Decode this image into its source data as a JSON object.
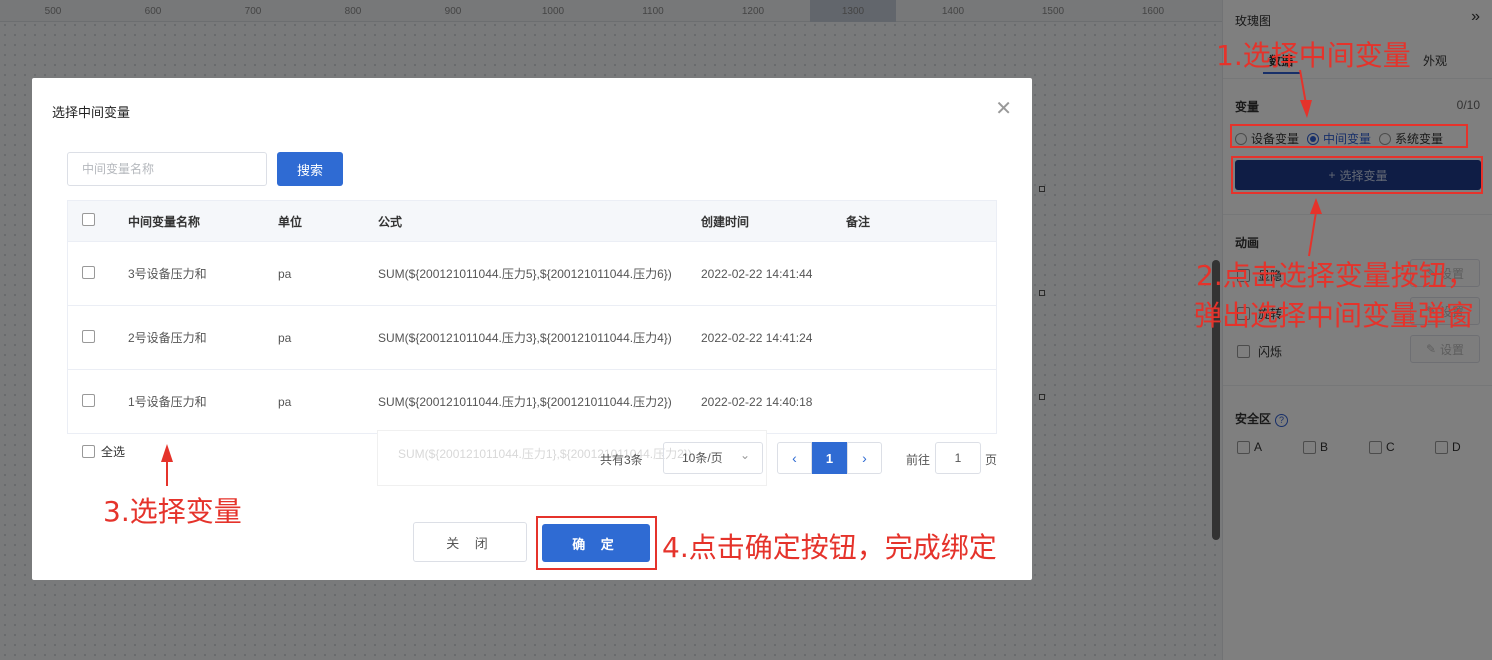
{
  "ruler": {
    "labels": [
      "500",
      "600",
      "700",
      "800",
      "900",
      "1000",
      "1100",
      "1200",
      "1300",
      "1400",
      "1500",
      "1600"
    ]
  },
  "panel": {
    "title": "玫瑰图",
    "collapse_icon": "double-chevron-right-icon",
    "tabs": [
      "数据",
      "外观"
    ],
    "variables_label": "变量",
    "variables_count": "0/10",
    "radio_options": [
      "设备变量",
      "中间变量",
      "系统变量"
    ],
    "radio_selected": "中间变量",
    "select_button": "选择变量",
    "animation_label": "动画",
    "animations": [
      {
        "label": "显隐",
        "set": "设置"
      },
      {
        "label": "旋转",
        "set": "设置"
      },
      {
        "label": "闪烁",
        "set": "设置"
      }
    ],
    "safe_zone_label": "安全区",
    "safe_zones": [
      "A",
      "B",
      "C",
      "D"
    ]
  },
  "modal": {
    "title": "选择中间变量",
    "search_placeholder": "中间变量名称",
    "search_button": "搜索",
    "columns": [
      "中间变量名称",
      "单位",
      "公式",
      "创建时间",
      "备注"
    ],
    "rows": [
      {
        "name": "3号设备压力和",
        "unit": "pa",
        "formula": "SUM(${200121011044.压力5},${200121011044.压力6})",
        "created": "2022-02-22 14:41:44",
        "note": ""
      },
      {
        "name": "2号设备压力和",
        "unit": "pa",
        "formula": "SUM(${200121011044.压力3},${200121011044.压力4})",
        "created": "2022-02-22 14:41:24",
        "note": ""
      },
      {
        "name": "1号设备压力和",
        "unit": "pa",
        "formula": "SUM(${200121011044.压力1},${200121011044.压力2})",
        "created": "2022-02-22 14:40:18",
        "note": ""
      }
    ],
    "select_all": "全选",
    "ghost_formula": "SUM(${200121011044.压力1},${200121011044.压力2})",
    "pagination": {
      "total": "共有3条",
      "page_size": "10条/页",
      "current_page": "1",
      "goto_label": "前往",
      "goto_value": "1",
      "page_unit": "页"
    },
    "cancel_button": "关 闭",
    "confirm_button": "确 定"
  },
  "annotations": {
    "step1": "1.选择中间变量",
    "step2_line1": "2.点击选择变量按钮，",
    "step2_line2": "弹出选择中间变量弹窗",
    "step3": "3.选择变量",
    "step4": "4.点击确定按钮，完成绑定",
    "color": "#e5332b"
  }
}
